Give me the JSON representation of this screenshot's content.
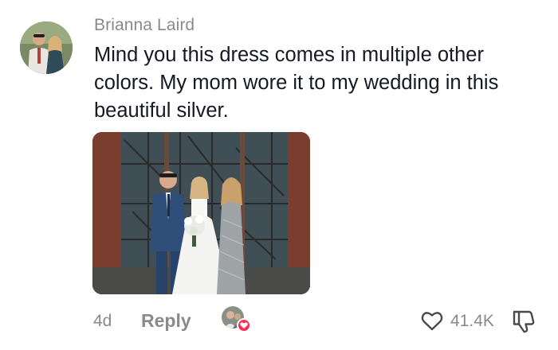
{
  "comment": {
    "username": "Brianna Laird",
    "text": "Mind you this dress comes in multiple other colors. My mom wore it to my wedding in this beautiful silver.",
    "timestamp": "4d",
    "reply_label": "Reply",
    "like_count": "41.4K"
  },
  "icons": {
    "like": "heart-outline-icon",
    "dislike": "thumbs-down-icon",
    "creator_liked": "heart-badge-icon"
  },
  "colors": {
    "username": "#8a8a8a",
    "text": "#161823",
    "muted": "#8a8a8a",
    "creator_heart": "#fe2c55"
  }
}
